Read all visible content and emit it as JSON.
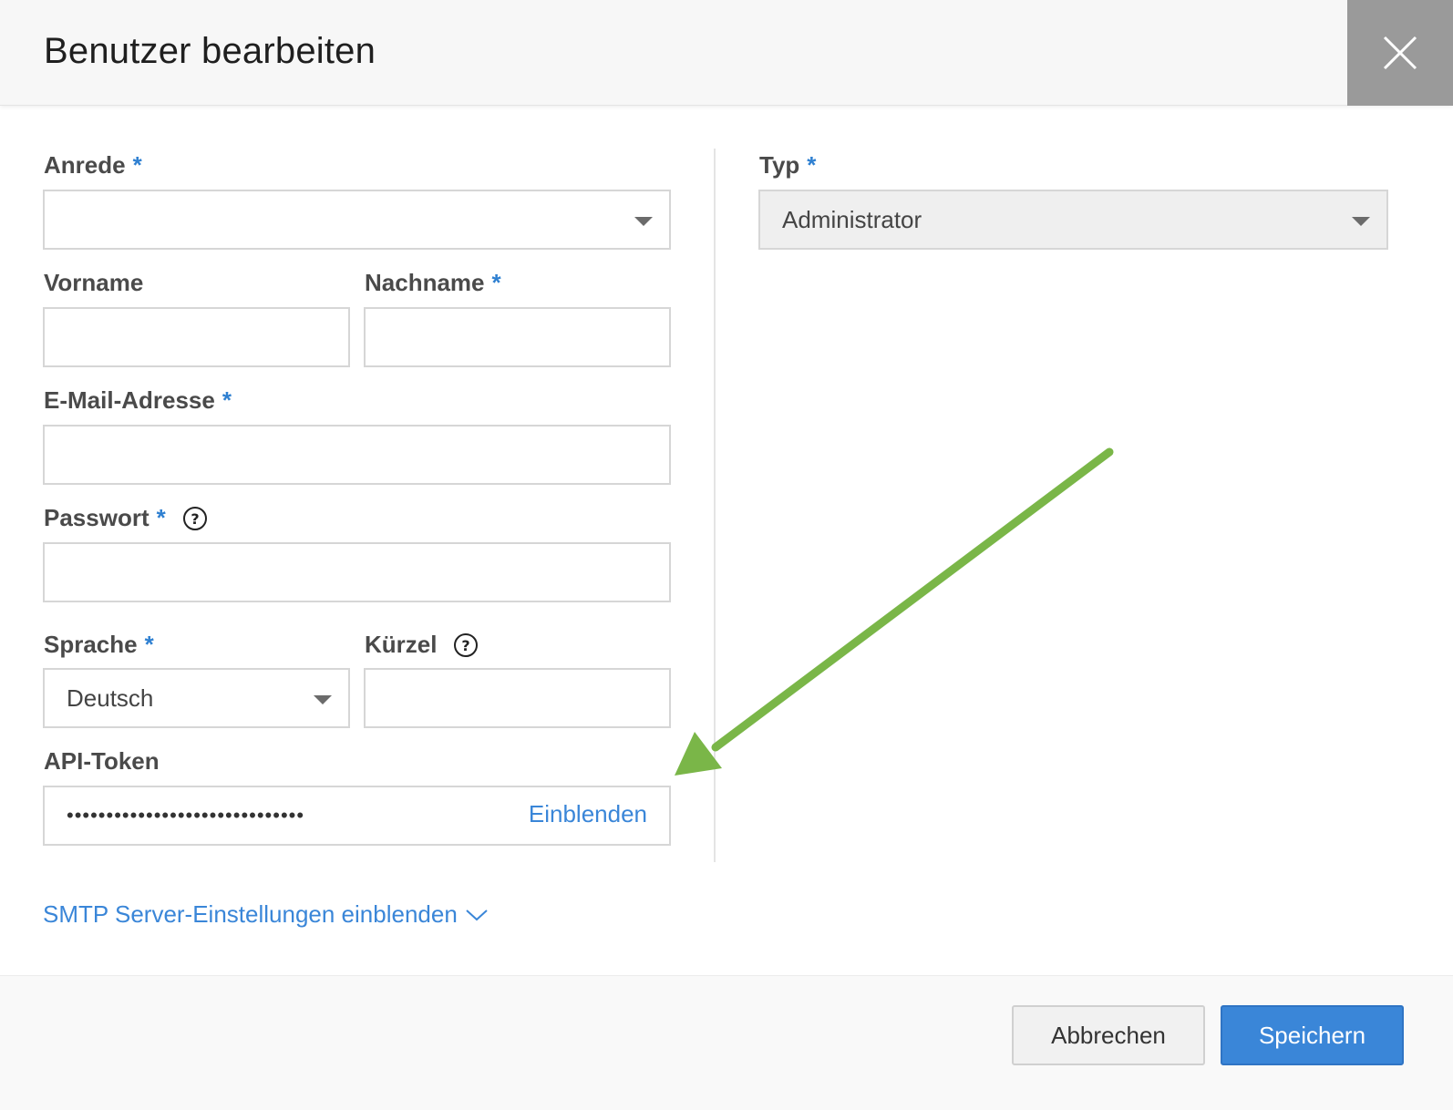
{
  "dialog": {
    "title": "Benutzer bearbeiten",
    "close_icon": "close-icon"
  },
  "form": {
    "required_marker": "*",
    "salutation": {
      "label": "Anrede",
      "value": ""
    },
    "first_name": {
      "label": "Vorname",
      "value": ""
    },
    "last_name": {
      "label": "Nachname",
      "value": ""
    },
    "email": {
      "label": "E-Mail-Adresse",
      "value": ""
    },
    "password": {
      "label": "Passwort",
      "value": "",
      "help_icon": "question-circle-icon"
    },
    "language": {
      "label": "Sprache",
      "value": "Deutsch"
    },
    "initials": {
      "label": "Kürzel",
      "value": "",
      "help_icon": "question-circle-icon"
    },
    "api_token": {
      "label": "API-Token",
      "masked_value": "••••••••••••••••••••••••••••••",
      "reveal_label": "Einblenden"
    },
    "type": {
      "label": "Typ",
      "value": "Administrator"
    },
    "smtp_toggle": {
      "label": "SMTP Server-Einstellungen einblenden",
      "icon": "chevron-down-icon"
    }
  },
  "footer": {
    "cancel_label": "Abbrechen",
    "save_label": "Speichern"
  },
  "annotation": {
    "arrow_color": "#7ab648",
    "arrow_icon": "annotation-arrow"
  },
  "colors": {
    "accent": "#3a86d8",
    "required": "#2f80d1",
    "close_bg": "#9a9a9a"
  }
}
